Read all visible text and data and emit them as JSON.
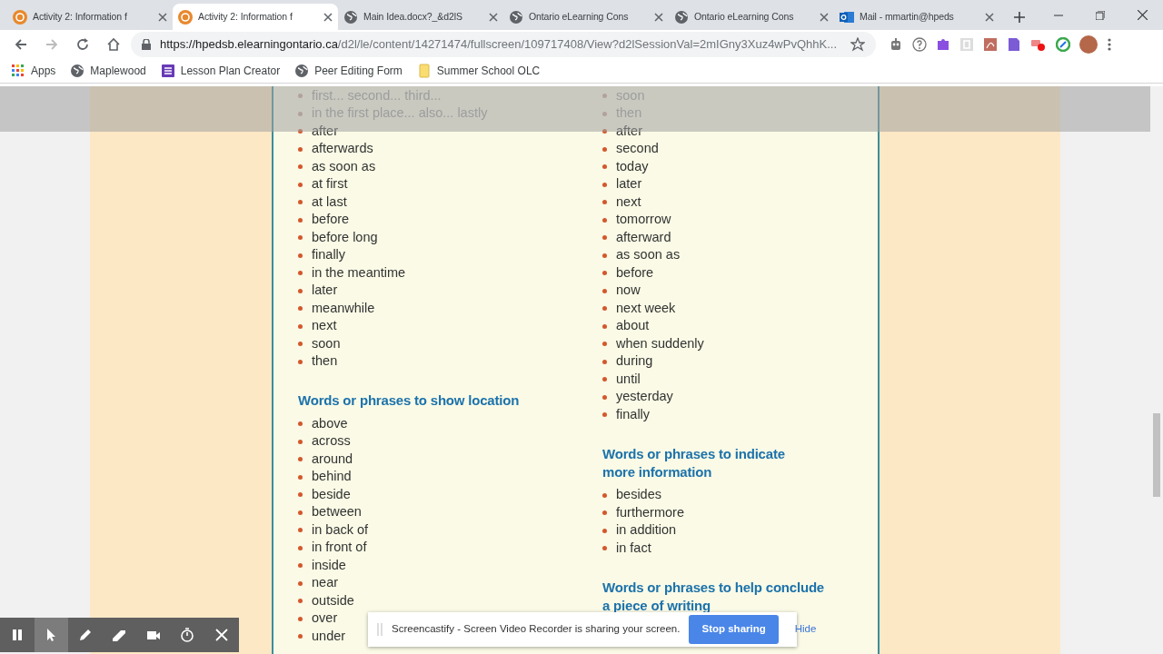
{
  "browser": {
    "tabs": [
      {
        "title": "Activity 2: Information f",
        "selected": false
      },
      {
        "title": "Activity 2: Information f",
        "selected": true
      },
      {
        "title": "Main Idea.docx?_&d2lS",
        "selected": false
      },
      {
        "title": "Ontario eLearning Cons",
        "selected": false
      },
      {
        "title": "Ontario eLearning Cons",
        "selected": false
      },
      {
        "title": "Mail - mmartin@hpeds",
        "selected": false
      }
    ],
    "url_host": "https://hpedsb.elearningontario.ca",
    "url_path": "/d2l/le/content/14271474/fullscreen/109717408/View?d2lSessionVal=2mIGny3Xuz4wPvQhhK...",
    "bookmarks": [
      {
        "label": "Apps"
      },
      {
        "label": "Maplewood"
      },
      {
        "label": "Lesson Plan Creator"
      },
      {
        "label": "Peer Editing Form"
      },
      {
        "label": "Summer School OLC"
      }
    ]
  },
  "columns": [
    {
      "sections": [
        {
          "items": [
            {
              "text": "first... second... third...",
              "covered": true
            },
            {
              "text": "in the first place... also... lastly",
              "covered": true
            },
            {
              "text": "after",
              "covered": false
            },
            {
              "text": "afterwards",
              "covered": false
            },
            {
              "text": "as soon as",
              "covered": false
            },
            {
              "text": "at first",
              "covered": false
            },
            {
              "text": "at last",
              "covered": false
            },
            {
              "text": "before",
              "covered": false
            },
            {
              "text": "before long",
              "covered": false
            },
            {
              "text": "finally",
              "covered": false
            },
            {
              "text": "in the meantime",
              "covered": false
            },
            {
              "text": "later",
              "covered": false
            },
            {
              "text": "meanwhile",
              "covered": false
            },
            {
              "text": "next",
              "covered": false
            },
            {
              "text": "soon",
              "covered": false
            },
            {
              "text": "then",
              "covered": false
            }
          ]
        },
        {
          "heading": "Words or phrases to show location",
          "items": [
            {
              "text": "above",
              "covered": false
            },
            {
              "text": "across",
              "covered": false
            },
            {
              "text": "around",
              "covered": false
            },
            {
              "text": "behind",
              "covered": false
            },
            {
              "text": "beside",
              "covered": false
            },
            {
              "text": "between",
              "covered": false
            },
            {
              "text": "in back of",
              "covered": false
            },
            {
              "text": "in front of",
              "covered": false
            },
            {
              "text": "inside",
              "covered": false
            },
            {
              "text": "near",
              "covered": false
            },
            {
              "text": "outside",
              "covered": false
            },
            {
              "text": "over",
              "covered": false
            },
            {
              "text": "under",
              "covered": false
            }
          ]
        }
      ]
    },
    {
      "sections": [
        {
          "items": [
            {
              "text": "soon",
              "covered": true
            },
            {
              "text": "then",
              "covered": true
            },
            {
              "text": "after",
              "covered": false
            },
            {
              "text": "second",
              "covered": false
            },
            {
              "text": "today",
              "covered": false
            },
            {
              "text": "later",
              "covered": false
            },
            {
              "text": "next",
              "covered": false
            },
            {
              "text": "tomorrow",
              "covered": false
            },
            {
              "text": "afterward",
              "covered": false
            },
            {
              "text": "as soon as",
              "covered": false
            },
            {
              "text": "before",
              "covered": false
            },
            {
              "text": "now",
              "covered": false
            },
            {
              "text": "next week",
              "covered": false
            },
            {
              "text": "about",
              "covered": false
            },
            {
              "text": "when suddenly",
              "covered": false
            },
            {
              "text": "during",
              "covered": false
            },
            {
              "text": "until",
              "covered": false
            },
            {
              "text": "yesterday",
              "covered": false
            },
            {
              "text": "finally",
              "covered": false
            }
          ]
        },
        {
          "heading": "Words or phrases to indicate\nmore information",
          "items": [
            {
              "text": "besides",
              "covered": false
            },
            {
              "text": "furthermore",
              "covered": false
            },
            {
              "text": "in addition",
              "covered": false
            },
            {
              "text": "in fact",
              "covered": false
            }
          ]
        },
        {
          "heading": "Words or phrases to help conclude\na piece of writing"
        }
      ]
    }
  ],
  "recorder": {
    "tools": [
      {
        "kind": "pause",
        "selected": false
      },
      {
        "kind": "pointer",
        "selected": true
      },
      {
        "kind": "pen",
        "selected": false
      },
      {
        "kind": "eraser",
        "selected": false
      },
      {
        "kind": "camera",
        "selected": false
      },
      {
        "kind": "timer",
        "selected": false
      },
      {
        "kind": "close",
        "selected": false
      }
    ]
  },
  "sharing_banner": {
    "message": "Screencastify - Screen Video Recorder is sharing your screen.",
    "stop_button": "Stop sharing",
    "hide_link": "Hide"
  }
}
